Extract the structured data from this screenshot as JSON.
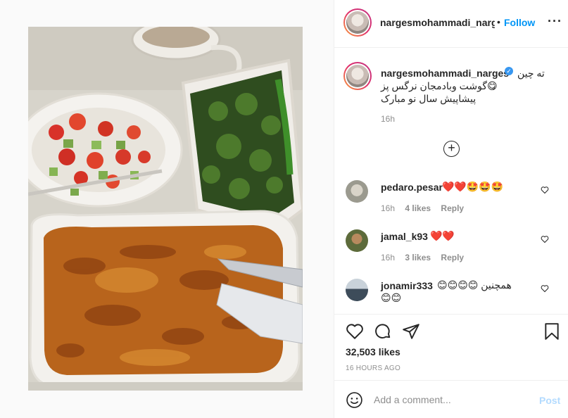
{
  "header": {
    "username": "nargesmohammadi_narges",
    "separator": "•",
    "follow_label": "Follow",
    "more_label": "···"
  },
  "caption": {
    "username": "nargesmohammadi_narges",
    "verified_mark": "✓",
    "line1": "ته چین",
    "line2": "😋گوشت وبادمجان نرگس پز",
    "line3": "پیشاپیش سال نو مبارک",
    "time": "16h"
  },
  "load_more_label": "+",
  "comments": [
    {
      "username": "pedaro.pesar",
      "text": "❤️❤️🤩🤩🤩",
      "time": "16h",
      "likes": "4 likes",
      "reply": "Reply"
    },
    {
      "username": "jamal_k93",
      "text": "❤️❤️",
      "time": "16h",
      "likes": "3 likes",
      "reply": "Reply"
    },
    {
      "username": "jonamir333",
      "text": "همچنین 😊😊😊😊",
      "text2": "😊😊"
    }
  ],
  "likes_count": "32,503 likes",
  "posted_ago": "16 HOURS AGO",
  "comment_bar": {
    "placeholder": "Add a comment...",
    "post_label": "Post"
  },
  "icons": [
    "heart-icon",
    "comment-icon",
    "share-icon",
    "bookmark-icon",
    "emoji-icon",
    "more-options-icon",
    "plus-circle-icon"
  ],
  "colors": {
    "accent": "#0095f6",
    "post_disabled": "#b3dbff",
    "muted": "#8e8e8e",
    "verified": "#3897f0"
  }
}
